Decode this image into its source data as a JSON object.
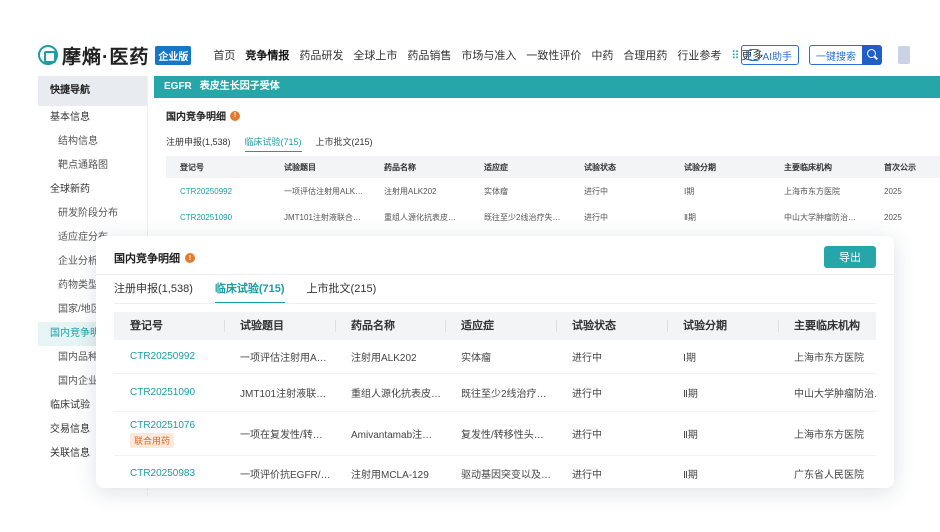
{
  "brand": {
    "name": "摩熵·医药",
    "badge": "企业版"
  },
  "nav": {
    "items": [
      {
        "label": "首页",
        "active": false
      },
      {
        "label": "竞争情报",
        "active": true
      },
      {
        "label": "药品研发",
        "active": false
      },
      {
        "label": "全球上市",
        "active": false
      },
      {
        "label": "药品销售",
        "active": false
      },
      {
        "label": "市场与准入",
        "active": false
      },
      {
        "label": "一致性评价",
        "active": false
      },
      {
        "label": "中药",
        "active": false
      },
      {
        "label": "合理用药",
        "active": false
      },
      {
        "label": "行业参考",
        "active": false
      },
      {
        "label": "更多",
        "active": false
      }
    ],
    "ai_label": "AI助手",
    "search_label": "一键搜索"
  },
  "sidebar": {
    "items": [
      {
        "label": "快捷导航",
        "type": "head"
      },
      {
        "label": "基本信息",
        "type": "group"
      },
      {
        "label": "结构信息",
        "type": "sub"
      },
      {
        "label": "靶点通路图",
        "type": "sub"
      },
      {
        "label": "全球新药",
        "type": "group"
      },
      {
        "label": "研发阶段分布",
        "type": "sub"
      },
      {
        "label": "适应症分布",
        "type": "sub"
      },
      {
        "label": "企业分析",
        "type": "sub"
      },
      {
        "label": "药物类型",
        "type": "sub"
      },
      {
        "label": "国家/地区",
        "type": "sub"
      },
      {
        "label": "国内竞争明细",
        "type": "active"
      },
      {
        "label": "国内品种",
        "type": "sub"
      },
      {
        "label": "国内企业",
        "type": "sub"
      },
      {
        "label": "临床试验",
        "type": "group"
      },
      {
        "label": "交易信息",
        "type": "group"
      },
      {
        "label": "关联信息",
        "type": "group"
      }
    ]
  },
  "banner": {
    "code": "EGFR",
    "name": "表皮生长因子受体"
  },
  "section": {
    "title": "国内竞争明细",
    "export_label": "导出",
    "tabs": [
      {
        "label": "注册申报(1,538)",
        "active": false
      },
      {
        "label": "临床试验(715)",
        "active": true
      },
      {
        "label": "上市批文(215)",
        "active": false
      }
    ]
  },
  "bg_table": {
    "columns": [
      "登记号",
      "试验题目",
      "药品名称",
      "适应症",
      "试验状态",
      "试验分期",
      "主要临床机构",
      "首次公示"
    ],
    "rows": [
      [
        "CTR20250992",
        "一项评估注射用ALK…",
        "注射用ALK202",
        "实体瘤",
        "进行中",
        "Ⅰ期",
        "上海市东方医院",
        "2025"
      ],
      [
        "CTR20251090",
        "JMT101注射液联合…",
        "重组人源化抗表皮…",
        "既往至少2线治疗失…",
        "进行中",
        "Ⅱ期",
        "中山大学肿瘤防治…",
        "2025"
      ]
    ]
  },
  "table": {
    "columns": [
      "登记号",
      "试验题目",
      "药品名称",
      "适应症",
      "试验状态",
      "试验分期",
      "主要临床机构"
    ],
    "rows": [
      {
        "id": "CTR20250992",
        "tag": "",
        "title": "一项评估注射用A…",
        "drug": "注射用ALK202",
        "indication": "实体瘤",
        "status": "进行中",
        "phase": "Ⅰ期",
        "site": "上海市东方医院"
      },
      {
        "id": "CTR20251090",
        "tag": "",
        "title": "JMT101注射液联…",
        "drug": "重组人源化抗表皮…",
        "indication": "既往至少2线治疗…",
        "status": "进行中",
        "phase": "Ⅱ期",
        "site": "中山大学肿瘤防治…"
      },
      {
        "id": "CTR20251076",
        "tag": "联合用药",
        "title": "一项在复发性/转…",
        "drug": "Amivantamab注…",
        "indication": "复发性/转移性头…",
        "status": "进行中",
        "phase": "Ⅱ期",
        "site": "上海市东方医院"
      },
      {
        "id": "CTR20250983",
        "tag": "",
        "title": "一项评价抗EGFR/…",
        "drug": "注射用MCLA-129",
        "indication": "驱动基因突变以及…",
        "status": "进行中",
        "phase": "Ⅱ期",
        "site": "广东省人民医院"
      }
    ]
  },
  "colors": {
    "accent": "#1a9ea3",
    "banner": "#27a6a9",
    "tag_bg": "#fde9dc",
    "tag_text": "#e06a1f",
    "info": "#e57a2f"
  }
}
